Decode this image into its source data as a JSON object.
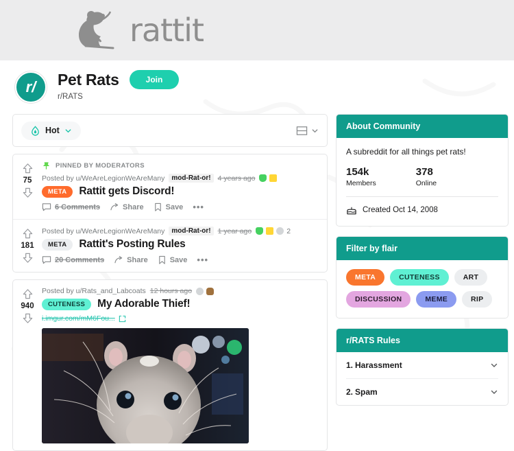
{
  "site": {
    "logo_text": "rattit",
    "logo_icon": "rat-logo-icon"
  },
  "community": {
    "avatar_text": "r/",
    "title": "Pet Rats",
    "join_label": "Join",
    "name": "r/RATS"
  },
  "sortbar": {
    "sort_label": "Hot",
    "sort_icon": "flame-icon",
    "chevron_icon": "chevron-down-icon",
    "view_icon": "card-view-icon"
  },
  "posts": [
    {
      "pinned_label": "PINNED BY MODERATORS",
      "pin_icon": "pushpin-icon",
      "posted_by": "Posted by u/WeAreLegionWeAreMany",
      "mod_badge": "mod-Rat-or!",
      "time": "4 years ago",
      "score": "75",
      "flair": "META",
      "flair_style": "flair-meta-orange",
      "title": "Rattit gets Discord!",
      "comments": "6 Comments",
      "share": "Share",
      "save": "Save",
      "more": "•••",
      "awards": [
        "green",
        "gold"
      ],
      "award_count": ""
    },
    {
      "pinned_label": "",
      "posted_by": "Posted by u/WeAreLegionWeAreMany",
      "mod_badge": "mod-Rat-or!",
      "time": "1 year ago",
      "score": "181",
      "flair": "META",
      "flair_style": "flair-meta-gray",
      "title": "Rattit's Posting Rules",
      "comments": "20 Comments",
      "share": "Share",
      "save": "Save",
      "more": "•••",
      "awards": [
        "green",
        "gold",
        "gray"
      ],
      "award_count": "2"
    },
    {
      "pinned_label": "",
      "posted_by": "Posted by u/Rats_and_Labcoats",
      "mod_badge": "",
      "time": "12 hours ago",
      "score": "940",
      "flair": "CUTENESS",
      "flair_style": "flair-cuteness",
      "title": "My Adorable Thief!",
      "link": "i.imgur.com/mM6Fou...",
      "link_icon": "external-link-icon",
      "image_alt": "close-up photo of a grey and white pet rat",
      "awards": [
        "gray",
        "brown"
      ],
      "award_count": ""
    }
  ],
  "sidebar": {
    "about": {
      "heading": "About Community",
      "description": "A subreddit for all things pet rats!",
      "members_value": "154k",
      "members_label": "Members",
      "online_value": "378",
      "online_label": "Online",
      "created": "Created Oct 14, 2008",
      "cake_icon": "cake-icon"
    },
    "flair_filter": {
      "heading": "Filter by flair",
      "flairs": [
        {
          "label": "META",
          "style": "fl-orange"
        },
        {
          "label": "CUTENESS",
          "style": "fl-teal"
        },
        {
          "label": "ART",
          "style": "fl-gray"
        },
        {
          "label": "DISCUSSION",
          "style": "fl-pink"
        },
        {
          "label": "MEME",
          "style": "fl-blue"
        },
        {
          "label": "RIP",
          "style": "fl-gray"
        }
      ]
    },
    "rules": {
      "heading": "r/RATS Rules",
      "items": [
        {
          "num": "1.",
          "text": "Harassment"
        },
        {
          "num": "2.",
          "text": "Spam"
        }
      ]
    }
  },
  "colors": {
    "brand_teal": "#109c8c",
    "join_teal": "#1ecfae",
    "flair_orange": "#ff6b2c",
    "header_gray": "#ececed"
  }
}
